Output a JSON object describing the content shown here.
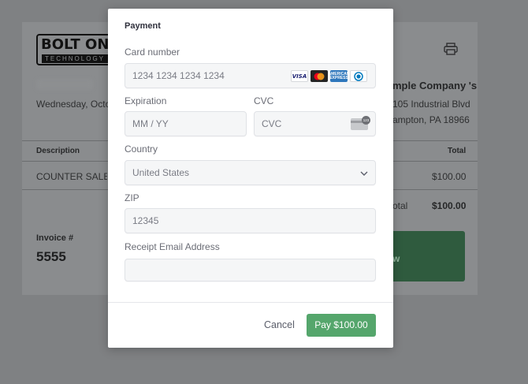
{
  "background": {
    "logo": {
      "main": "BOLT ON",
      "sub": "TECHNOLOGY"
    },
    "invoice_date": "Wednesday, Octob",
    "company_name": "mple Company 's",
    "company_address_line1": "105 Industrial Blvd",
    "company_address_line2": "ampton, PA 18966",
    "table": {
      "header_description": "Description",
      "header_total": "Total",
      "row_description": "COUNTER SALE TH",
      "row_amount": "$100.00"
    },
    "subtotal_label": "otal",
    "subtotal_amount": "$100.00",
    "invoice_number_label": "Invoice #",
    "invoice_number": "5555",
    "pay_button_fragment": "w"
  },
  "modal": {
    "title": "Payment",
    "card_number": {
      "label": "Card number",
      "placeholder": "1234 1234 1234 1234",
      "visa_text": "VISA",
      "amex_text": "AMERICAN EXPRESS"
    },
    "expiration": {
      "label": "Expiration",
      "placeholder": "MM / YY"
    },
    "cvc": {
      "label": "CVC",
      "placeholder": "CVC",
      "badge": "123"
    },
    "country": {
      "label": "Country",
      "selected": "United States"
    },
    "zip": {
      "label": "ZIP",
      "value": "12345"
    },
    "receipt_email": {
      "label": "Receipt Email Address",
      "value": ""
    },
    "cancel_label": "Cancel",
    "pay_label": "Pay $100.00"
  },
  "colors": {
    "overlay": "#7f8183",
    "pay_button": "#55a66c",
    "field_background": "#f5f6f7"
  },
  "icons": [
    "printer-icon",
    "visa-icon",
    "mastercard-icon",
    "amex-icon",
    "diners-icon",
    "cvc-card-icon",
    "chevron-down-icon"
  ]
}
